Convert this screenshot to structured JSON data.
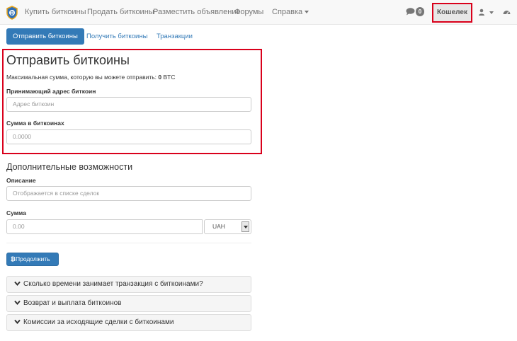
{
  "navbar": {
    "menu": [
      "Купить биткоины",
      "Продать биткоины",
      "Разместить объявление",
      "Форумы",
      "Справка"
    ],
    "messages_count": "0",
    "wallet_label": "Кошелек"
  },
  "tabs": [
    "Отправить биткоины",
    "Получить биткоины",
    "Транзакции"
  ],
  "send": {
    "title": "Отправить биткоины",
    "max_prefix": "Максимальная сумма, которую вы можете отправить: ",
    "max_value": "0",
    "max_unit": " BTC",
    "address_label": "Принимающий адрес биткоин",
    "address_placeholder": "Адрес биткоин",
    "amount_label": "Сумма в биткоинах",
    "amount_placeholder": "0.0000"
  },
  "extra": {
    "title": "Дополнительные возможности",
    "description_label": "Описание",
    "description_placeholder": "Отображается в списке сделок",
    "sum_label": "Сумма",
    "sum_placeholder": "0.00",
    "currency": "UAH"
  },
  "continue_label": "Продолжить",
  "faq": [
    "Сколько времени занимает транзакция с биткоинами?",
    "Возврат и выплата биткоинов",
    "Комиссии за исходящие сделки с биткоинами"
  ],
  "colors": {
    "primary": "#337ab7",
    "highlight": "#d9001b",
    "logo": "#2f6fb6"
  }
}
